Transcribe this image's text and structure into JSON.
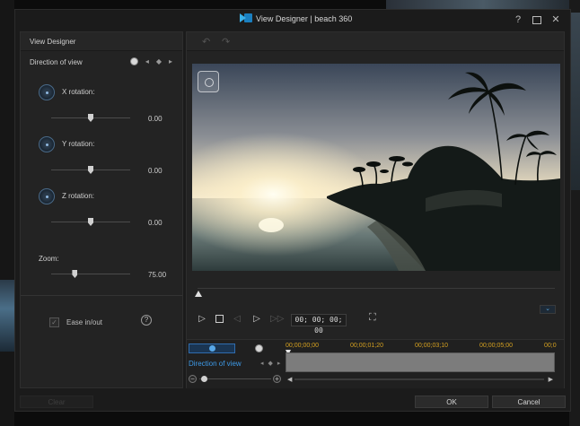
{
  "window": {
    "title": "View Designer  |  beach 360",
    "help_label": "?",
    "close_label": "✕"
  },
  "left_panel": {
    "header": "View Designer",
    "direction_label": "Direction of view",
    "x_rotation": {
      "label": "X rotation:",
      "value": "0.00",
      "slider_fraction": 0.5
    },
    "y_rotation": {
      "label": "Y rotation:",
      "value": "0.00",
      "slider_fraction": 0.5
    },
    "z_rotation": {
      "label": "Z rotation:",
      "value": "0.00",
      "slider_fraction": 0.5
    },
    "zoom": {
      "label": "Zoom:",
      "value": "75.00",
      "slider_fraction": 0.3
    },
    "ease_label": "Ease in/out",
    "ease_checked": true,
    "help_label": "?"
  },
  "player": {
    "timecode": "00; 00; 00; 00"
  },
  "timeline": {
    "ruler_ticks": [
      "00;00;00;00",
      "00;00;01;20",
      "00;00;03;10",
      "00;00;05;00",
      "00;0"
    ],
    "track_label": "Direction of view"
  },
  "buttons": {
    "clear": "Clear",
    "ok": "OK",
    "cancel": "Cancel"
  },
  "colors": {
    "accent": "#3d9ae8",
    "ruler": "#d4a020"
  }
}
